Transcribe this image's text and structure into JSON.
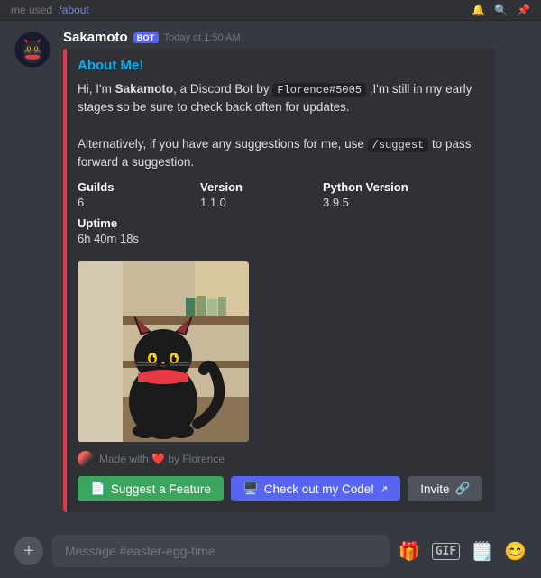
{
  "topbar": {
    "user": "me used",
    "command": "/about",
    "icons": [
      "🔔",
      "🔍",
      "📌"
    ]
  },
  "message": {
    "username": "Sakamoto",
    "bot_label": "BOT",
    "timestamp": "Today at 1:50 AM",
    "embed": {
      "title": "About Me!",
      "description_parts": [
        "Hi, I'm ",
        "Sakamoto",
        ", a Discord Bot by ",
        "Florence#5005",
        " ,I'm still in my early stages so be sure to check back often for updates.",
        "\n\nAlternatively, if you have any suggestions for me, use ",
        "/suggest",
        " to pass forward a suggestion."
      ],
      "fields": [
        {
          "name": "Guilds",
          "value": "6"
        },
        {
          "name": "Version",
          "value": "1.1.0"
        },
        {
          "name": "Python Version",
          "value": "3.9.5"
        },
        {
          "name": "Uptime",
          "value": "6h 40m 18s"
        }
      ],
      "footer": "Made with ❤️ by Florence",
      "buttons": [
        {
          "label": "Suggest a Feature",
          "type": "green",
          "icon": "📄"
        },
        {
          "label": "Check out my Code!",
          "type": "blurple",
          "icon": "🖥️",
          "external": true
        },
        {
          "label": "Invite",
          "type": "gray",
          "icon": "🔗"
        }
      ]
    }
  },
  "input": {
    "placeholder": "Message #easter-egg-time"
  }
}
